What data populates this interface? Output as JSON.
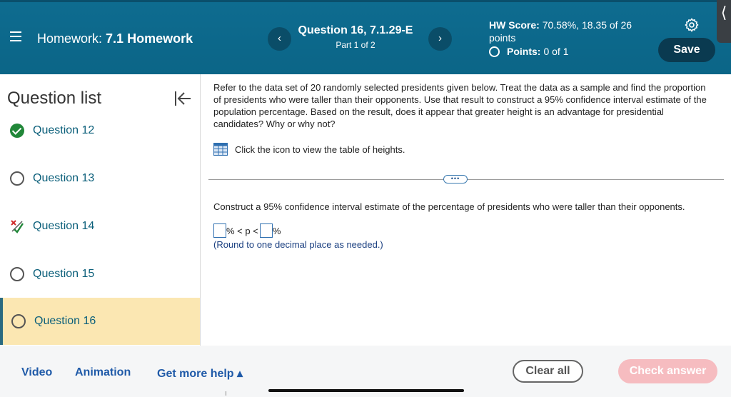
{
  "header": {
    "homework_prefix": "Homework:",
    "homework_name": "7.1 Homework",
    "question_title": "Question 16, 7.1.29-E",
    "question_part": "Part 1 of 2",
    "prev_glyph": "‹",
    "next_glyph": "›",
    "hw_score_label": "HW Score:",
    "hw_score_value": "70.58%, 18.35 of 26 points",
    "points_label": "Points:",
    "points_value": "0 of 1",
    "save_label": "Save",
    "side_tab_glyph": "⟨"
  },
  "sidebar": {
    "title": "Question list",
    "items": [
      {
        "label": "Question 12",
        "status": "correct"
      },
      {
        "label": "Question 13",
        "status": "unanswered"
      },
      {
        "label": "Question 14",
        "status": "partial"
      },
      {
        "label": "Question 15",
        "status": "unanswered"
      },
      {
        "label": "Question 16",
        "status": "current"
      }
    ]
  },
  "main": {
    "prompt": "Refer to the data set of 20 randomly selected presidents given below. Treat the data as a sample and find the proportion of presidents who were taller than their opponents. Use that result to construct a 95% confidence interval estimate of the population percentage. Based on the result, does it appear that greater height is an advantage for presidential candidates? Why or why not?",
    "table_link": "Click the icon to view the table of heights.",
    "more_glyph": "•••",
    "construct": "Construct a 95% confidence interval estimate of the percentage of presidents who were taller than their opponents.",
    "ci_middle": "% < p <",
    "ci_end": "%",
    "round_note": "(Round to one decimal place as needed.)"
  },
  "footer": {
    "video": "Video",
    "animation": "Animation",
    "help": "Get more help ▴",
    "clear": "Clear all",
    "check": "Check answer"
  },
  "colors": {
    "header_bg": "#0e6c90",
    "active_item_bg": "#fbe7b2",
    "check_answer_bg": "#f6bcc0",
    "link": "#1f5aa8",
    "correct": "#218739"
  },
  "icons": [
    "menu-icon",
    "chevron-left-icon",
    "chevron-right-icon",
    "radio-icon",
    "gear-icon",
    "collapse-sidebar-icon",
    "check-circle-icon",
    "partial-credit-icon",
    "table-icon",
    "more-icon"
  ]
}
